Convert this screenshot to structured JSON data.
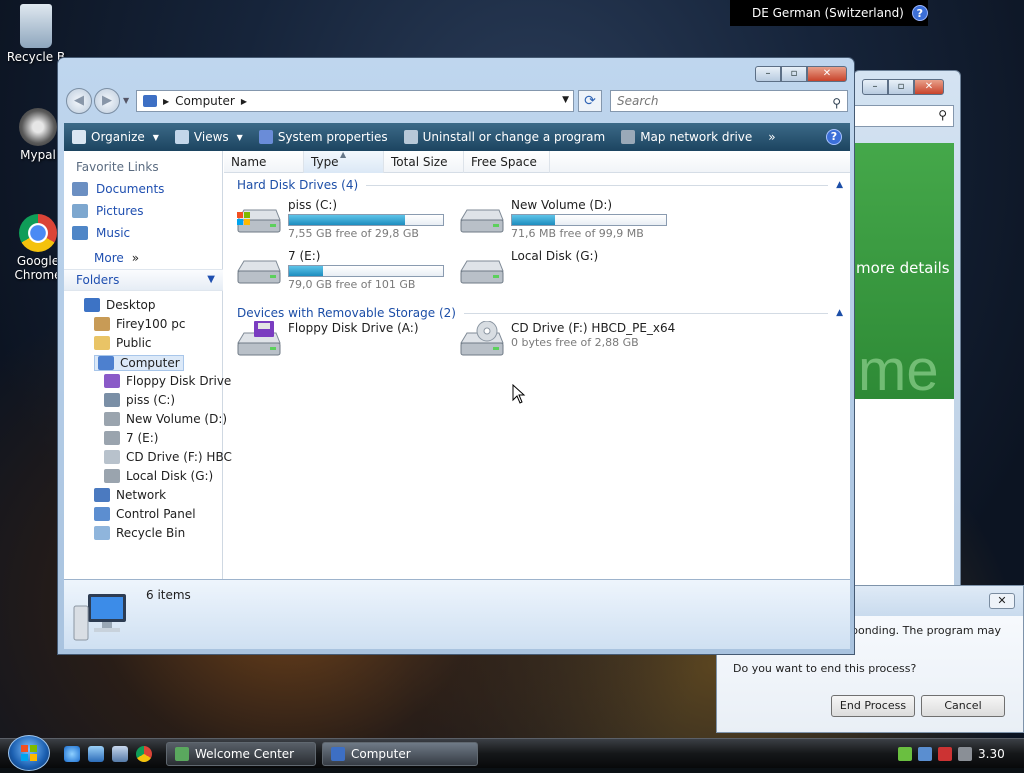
{
  "desktop": {
    "icons": [
      {
        "label": "Recycle B",
        "icon": "recycle-bin-icon"
      },
      {
        "label": "Mypal",
        "icon": "mypal-icon"
      },
      {
        "label": "Google Chrome",
        "icon": "chrome-icon"
      }
    ]
  },
  "language_bar": {
    "label": "DE German (Switzerland)",
    "help": "?"
  },
  "background_window": {
    "banner_text": "more details",
    "banner_big": "me"
  },
  "dialog": {
    "close": "✕",
    "message_partial": "ponding. The program may",
    "question": "Do you want to end this process?",
    "end_button": "End Process",
    "cancel_button": "Cancel"
  },
  "explorer": {
    "caption": {
      "minimize": "–",
      "maximize": "▫",
      "close": "✕"
    },
    "address": {
      "location": "Computer",
      "dropdown": "▼"
    },
    "search_placeholder": "Search",
    "toolbar": [
      {
        "label": "Organize",
        "caret": true,
        "icon": "organize-icon",
        "color": "#d9e6f2"
      },
      {
        "label": "Views",
        "caret": true,
        "icon": "views-icon",
        "color": "#c3d6ea"
      },
      {
        "label": "System properties",
        "caret": false,
        "icon": "system-properties-icon",
        "color": "#6a8cd8"
      },
      {
        "label": "Uninstall or change a program",
        "caret": false,
        "icon": "uninstall-icon",
        "color": "#b7c8d8"
      },
      {
        "label": "Map network drive",
        "caret": false,
        "icon": "map-network-drive-icon",
        "color": "#9aa9b8"
      },
      {
        "label": "»",
        "caret": false,
        "icon": "",
        "color": ""
      }
    ],
    "help": "?",
    "favorites_header": "Favorite Links",
    "favorites": [
      {
        "label": "Documents",
        "color": "#6b8fc2"
      },
      {
        "label": "Pictures",
        "color": "#7da7cf"
      },
      {
        "label": "Music",
        "color": "#4f86c7"
      }
    ],
    "more": "More",
    "more_chevron": "»",
    "folders_header": "Folders",
    "tree": [
      {
        "label": "Desktop",
        "indent": 0,
        "color": "#3d73c5"
      },
      {
        "label": "Firey100 pc",
        "indent": 1,
        "color": "#c89b56"
      },
      {
        "label": "Public",
        "indent": 1,
        "color": "#e9c466"
      },
      {
        "label": "Computer",
        "indent": 1,
        "color": "#4d80cf",
        "selected": true
      },
      {
        "label": "Floppy Disk Drive",
        "indent": 2,
        "color": "#8a5ac8"
      },
      {
        "label": "piss (C:)",
        "indent": 2,
        "color": "#7a8fa6"
      },
      {
        "label": "New Volume (D:)",
        "indent": 2,
        "color": "#9aa4ae"
      },
      {
        "label": "7 (E:)",
        "indent": 2,
        "color": "#9aa4ae"
      },
      {
        "label": "CD Drive (F:) HBC",
        "indent": 2,
        "color": "#b8c2cc"
      },
      {
        "label": "Local Disk (G:)",
        "indent": 2,
        "color": "#9aa4ae"
      },
      {
        "label": "Network",
        "indent": 1,
        "color": "#4b7ac0"
      },
      {
        "label": "Control Panel",
        "indent": 1,
        "color": "#5c8ed0"
      },
      {
        "label": "Recycle Bin",
        "indent": 1,
        "color": "#8fb5dc"
      }
    ],
    "columns": [
      "Name",
      "Type",
      "Total Size",
      "Free Space"
    ],
    "groups": [
      {
        "label": "Hard Disk Drives (4)"
      },
      {
        "label": "Devices with Removable Storage (2)"
      }
    ],
    "drives": [
      {
        "name": "piss (C:)",
        "free": "7,55 GB free of 29,8 GB",
        "used_fraction": 0.75,
        "icon": "windows-drive-icon"
      },
      {
        "name": "New Volume (D:)",
        "free": "71,6 MB free of 99,9 MB",
        "used_fraction": 0.28,
        "icon": "hard-drive-icon"
      },
      {
        "name": "7 (E:)",
        "free": "79,0 GB free of 101 GB",
        "used_fraction": 0.22,
        "icon": "hard-drive-icon"
      },
      {
        "name": "Local Disk (G:)",
        "free": "",
        "icon": "hard-drive-icon"
      },
      {
        "name": "Floppy Disk Drive (A:)",
        "free": "",
        "icon": "floppy-drive-icon"
      },
      {
        "name": "CD Drive (F:) HBCD_PE_x64",
        "free": "0 bytes free of 2,88 GB",
        "icon": "cd-drive-icon"
      }
    ],
    "details": {
      "count": "6 items"
    }
  },
  "taskbar": {
    "tasks": [
      {
        "label": "Welcome Center"
      },
      {
        "label": "Computer"
      }
    ],
    "clock": "3.30"
  }
}
